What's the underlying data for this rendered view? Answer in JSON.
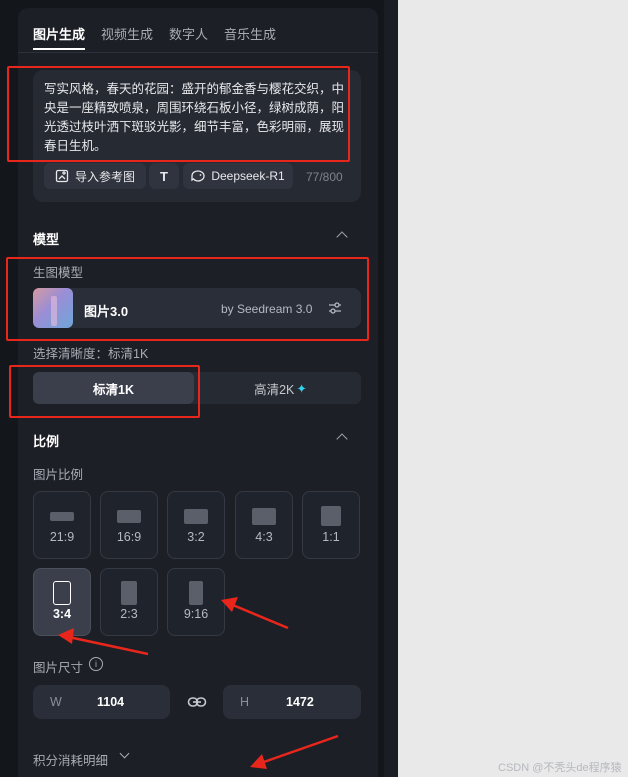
{
  "tabs": [
    {
      "label": "图片生成",
      "active": true
    },
    {
      "label": "视频生成",
      "active": false
    },
    {
      "label": "数字人",
      "active": false
    },
    {
      "label": "音乐生成",
      "active": false
    }
  ],
  "prompt": {
    "text": "写实风格，春天的花园：盛开的郁金香与樱花交织，中央是一座精致喷泉，周围环绕石板小径，绿树成荫，阳光透过枝叶洒下斑驳光影，细节丰富，色彩明丽，展现春日生机。",
    "import_label": "导入参考图",
    "text_tool_glyph": "T",
    "model_label": "Deepseek-R1",
    "counter": "77/800"
  },
  "model_section": {
    "title": "模型",
    "sublabel": "生图模型",
    "model_name": "图片3.0",
    "model_by": "by Seedream 3.0"
  },
  "quality": {
    "label": "选择清晰度：标清1K",
    "options": [
      {
        "label": "标清1K",
        "selected": true
      },
      {
        "label": "高清2K",
        "selected": false,
        "sparkle": "✦"
      }
    ]
  },
  "ratio_section": {
    "title": "比例",
    "sublabel": "图片比例",
    "options": [
      {
        "label": "21:9",
        "selected": false
      },
      {
        "label": "16:9",
        "selected": false
      },
      {
        "label": "3:2",
        "selected": false
      },
      {
        "label": "4:3",
        "selected": false
      },
      {
        "label": "1:1",
        "selected": false
      },
      {
        "label": "3:4",
        "selected": true
      },
      {
        "label": "2:3",
        "selected": false
      },
      {
        "label": "9:16",
        "selected": false
      }
    ]
  },
  "size_section": {
    "label": "图片尺寸",
    "info_glyph": "i",
    "width_letter": "W",
    "width": "1104",
    "height_letter": "H",
    "height": "1472"
  },
  "credits": {
    "label": "积分消耗明细"
  },
  "watermark": "CSDN @不秃头de程序猿",
  "colors": {
    "annotation_red": "#e8261c",
    "sparkle_cyan": "#2fd3ee",
    "panel_bg": "#1c1f26"
  }
}
